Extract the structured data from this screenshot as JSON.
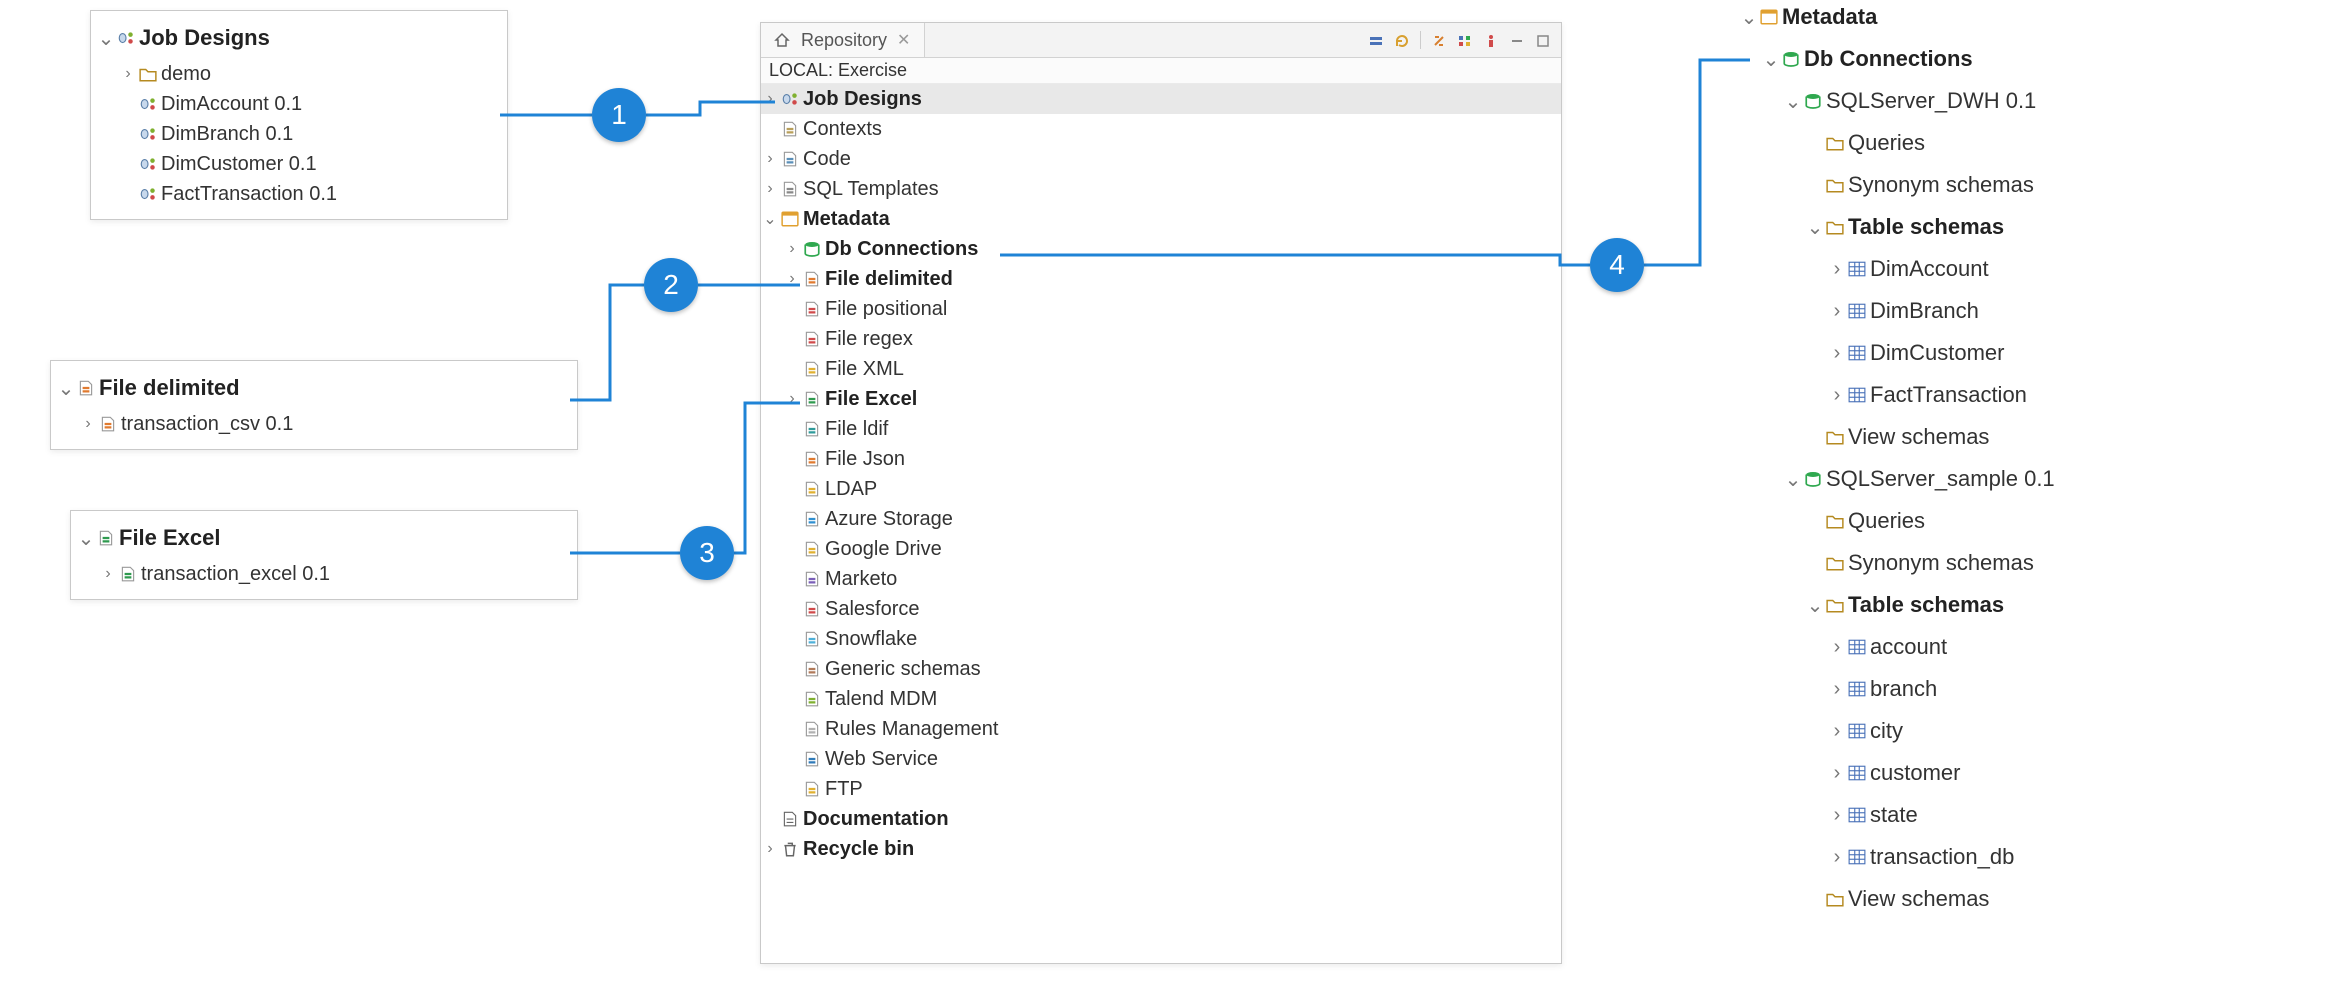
{
  "center": {
    "tabLabel": "Repository",
    "subTitle": "LOCAL: Exercise",
    "toolbarIcons": [
      "collapse-icon",
      "refresh-icon",
      "link-icon",
      "filter-icon",
      "activate-icon",
      "minimize-icon",
      "maximize-icon"
    ],
    "tree": [
      {
        "indent": 0,
        "tw": ">",
        "icon": "job-designs-icon",
        "label": "Job Designs",
        "bold": true,
        "sel": true,
        "interact": true
      },
      {
        "indent": 0,
        "tw": "",
        "icon": "contexts-icon",
        "label": "Contexts"
      },
      {
        "indent": 0,
        "tw": ">",
        "icon": "code-icon",
        "label": "Code",
        "interact": true
      },
      {
        "indent": 0,
        "tw": ">",
        "icon": "sql-templates-icon",
        "label": "SQL Templates",
        "interact": true
      },
      {
        "indent": 0,
        "tw": "v",
        "icon": "metadata-icon",
        "label": "Metadata",
        "bold": true,
        "interact": true
      },
      {
        "indent": 1,
        "tw": ">",
        "icon": "db-connections-icon",
        "label": "Db Connections",
        "bold": true,
        "interact": true
      },
      {
        "indent": 1,
        "tw": ">",
        "icon": "file-delimited-icon",
        "label": "File delimited",
        "bold": true,
        "interact": true
      },
      {
        "indent": 1,
        "tw": "",
        "icon": "file-positional-icon",
        "label": "File positional"
      },
      {
        "indent": 1,
        "tw": "",
        "icon": "file-regex-icon",
        "label": "File regex"
      },
      {
        "indent": 1,
        "tw": "",
        "icon": "file-xml-icon",
        "label": "File XML"
      },
      {
        "indent": 1,
        "tw": ">",
        "icon": "file-excel-icon",
        "label": "File Excel",
        "bold": true,
        "interact": true
      },
      {
        "indent": 1,
        "tw": "",
        "icon": "file-ldif-icon",
        "label": "File ldif"
      },
      {
        "indent": 1,
        "tw": "",
        "icon": "file-json-icon",
        "label": "File Json"
      },
      {
        "indent": 1,
        "tw": "",
        "icon": "ldap-icon",
        "label": "LDAP"
      },
      {
        "indent": 1,
        "tw": "",
        "icon": "azure-storage-icon",
        "label": "Azure Storage"
      },
      {
        "indent": 1,
        "tw": "",
        "icon": "google-drive-icon",
        "label": "Google Drive"
      },
      {
        "indent": 1,
        "tw": "",
        "icon": "marketo-icon",
        "label": "Marketo"
      },
      {
        "indent": 1,
        "tw": "",
        "icon": "salesforce-icon",
        "label": "Salesforce"
      },
      {
        "indent": 1,
        "tw": "",
        "icon": "snowflake-icon",
        "label": "Snowflake"
      },
      {
        "indent": 1,
        "tw": "",
        "icon": "generic-schemas-icon",
        "label": "Generic schemas"
      },
      {
        "indent": 1,
        "tw": "",
        "icon": "talend-mdm-icon",
        "label": "Talend MDM"
      },
      {
        "indent": 1,
        "tw": "",
        "icon": "rules-management-icon",
        "label": "Rules Management"
      },
      {
        "indent": 1,
        "tw": "",
        "icon": "web-service-icon",
        "label": "Web Service"
      },
      {
        "indent": 1,
        "tw": "",
        "icon": "ftp-icon",
        "label": "FTP"
      },
      {
        "indent": 0,
        "tw": "",
        "icon": "documentation-icon",
        "label": "Documentation",
        "bold": true
      },
      {
        "indent": 0,
        "tw": ">",
        "icon": "recycle-bin-icon",
        "label": "Recycle bin",
        "bold": true,
        "interact": true
      }
    ]
  },
  "leftJobDesigns": {
    "items": [
      {
        "indent": 0,
        "tw": "v",
        "icon": "job-designs-icon",
        "label": "Job Designs",
        "bold": true,
        "big": true
      },
      {
        "indent": 1,
        "tw": ">",
        "icon": "folder-icon",
        "label": "demo"
      },
      {
        "indent": 1,
        "tw": "",
        "icon": "job-item-icon",
        "label": "DimAccount 0.1"
      },
      {
        "indent": 1,
        "tw": "",
        "icon": "job-item-icon",
        "label": "DimBranch 0.1"
      },
      {
        "indent": 1,
        "tw": "",
        "icon": "job-item-icon",
        "label": "DimCustomer 0.1"
      },
      {
        "indent": 1,
        "tw": "",
        "icon": "job-item-icon",
        "label": "FactTransaction 0.1"
      }
    ]
  },
  "leftFileDelimited": {
    "items": [
      {
        "indent": 0,
        "tw": "v",
        "icon": "file-delimited-icon",
        "label": "File delimited",
        "bold": true,
        "big": true
      },
      {
        "indent": 1,
        "tw": ">",
        "icon": "file-delimited-icon",
        "label": "transaction_csv 0.1"
      }
    ]
  },
  "leftFileExcel": {
    "items": [
      {
        "indent": 0,
        "tw": "v",
        "icon": "file-excel-icon",
        "label": "File Excel",
        "bold": true,
        "big": true
      },
      {
        "indent": 1,
        "tw": ">",
        "icon": "file-excel-icon",
        "label": "transaction_excel 0.1"
      }
    ]
  },
  "right": {
    "items": [
      {
        "indent": 0,
        "tw": "v",
        "icon": "metadata-icon",
        "label": "Metadata",
        "bold": true,
        "big": true
      },
      {
        "indent": 1,
        "tw": "v",
        "icon": "db-connections-icon",
        "label": "Db Connections",
        "bold": true,
        "big": true
      },
      {
        "indent": 2,
        "tw": "v",
        "icon": "db-conn-item-icon",
        "label": "SQLServer_DWH 0.1",
        "big": true
      },
      {
        "indent": 3,
        "tw": "",
        "icon": "folder-icon",
        "label": "Queries",
        "big": true
      },
      {
        "indent": 3,
        "tw": "",
        "icon": "folder-icon",
        "label": "Synonym schemas",
        "big": true
      },
      {
        "indent": 3,
        "tw": "v",
        "icon": "folder-icon",
        "label": "Table schemas",
        "bold": true,
        "big": true
      },
      {
        "indent": 4,
        "tw": ">",
        "icon": "table-icon",
        "label": "DimAccount",
        "big": true
      },
      {
        "indent": 4,
        "tw": ">",
        "icon": "table-icon",
        "label": "DimBranch",
        "big": true
      },
      {
        "indent": 4,
        "tw": ">",
        "icon": "table-icon",
        "label": "DimCustomer",
        "big": true
      },
      {
        "indent": 4,
        "tw": ">",
        "icon": "table-icon",
        "label": "FactTransaction",
        "big": true
      },
      {
        "indent": 3,
        "tw": "",
        "icon": "folder-icon",
        "label": "View schemas",
        "big": true
      },
      {
        "indent": 2,
        "tw": "v",
        "icon": "db-conn-item-icon",
        "label": "SQLServer_sample 0.1",
        "big": true
      },
      {
        "indent": 3,
        "tw": "",
        "icon": "folder-icon",
        "label": "Queries",
        "big": true
      },
      {
        "indent": 3,
        "tw": "",
        "icon": "folder-icon",
        "label": "Synonym schemas",
        "big": true
      },
      {
        "indent": 3,
        "tw": "v",
        "icon": "folder-icon",
        "label": "Table schemas",
        "bold": true,
        "big": true
      },
      {
        "indent": 4,
        "tw": ">",
        "icon": "table-icon",
        "label": "account",
        "big": true
      },
      {
        "indent": 4,
        "tw": ">",
        "icon": "table-icon",
        "label": "branch",
        "big": true
      },
      {
        "indent": 4,
        "tw": ">",
        "icon": "table-icon",
        "label": "city",
        "big": true
      },
      {
        "indent": 4,
        "tw": ">",
        "icon": "table-icon",
        "label": "customer",
        "big": true
      },
      {
        "indent": 4,
        "tw": ">",
        "icon": "table-icon",
        "label": "state",
        "big": true
      },
      {
        "indent": 4,
        "tw": ">",
        "icon": "table-icon",
        "label": "transaction_db",
        "big": true
      },
      {
        "indent": 3,
        "tw": "",
        "icon": "folder-icon",
        "label": "View schemas",
        "big": true
      }
    ]
  },
  "markers": {
    "m1": "1",
    "m2": "2",
    "m3": "3",
    "m4": "4"
  },
  "iconColors": {
    "job-designs-icon": "#7fa7d8",
    "contexts-icon": "#b89f5a",
    "code-icon": "#5a8fb8",
    "sql-templates-icon": "#888",
    "metadata-icon": "#e0a030",
    "db-connections-icon": "#2fa84f",
    "db-conn-item-icon": "#2fa84f",
    "file-delimited-icon": "#e07a2f",
    "file-positional-icon": "#d04a4a",
    "file-regex-icon": "#d04a4a",
    "file-xml-icon": "#e0b030",
    "file-excel-icon": "#2f9a4f",
    "file-ldif-icon": "#2f9a9a",
    "file-json-icon": "#e07a2f",
    "ldap-icon": "#e0b030",
    "azure-storage-icon": "#2f8fd0",
    "google-drive-icon": "#e0b030",
    "marketo-icon": "#7a5fb8",
    "salesforce-icon": "#d04a4a",
    "snowflake-icon": "#4fb0d8",
    "generic-schemas-icon": "#b07a5a",
    "talend-mdm-icon": "#7fb02f",
    "rules-management-icon": "#b0b0b0",
    "web-service-icon": "#2f7ab8",
    "ftp-icon": "#e0b030",
    "documentation-icon": "#888",
    "recycle-bin-icon": "#888",
    "folder-icon": "#d9b96a",
    "job-item-icon": "#7fa7d8",
    "table-icon": "#4a72b8",
    "home-icon": "#888"
  }
}
